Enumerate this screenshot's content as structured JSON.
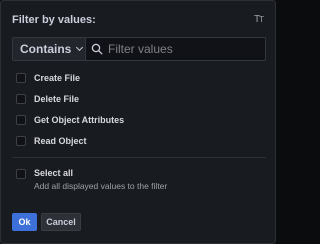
{
  "header": {
    "title": "Filter by values:",
    "toggle_icon": "text-case-icon"
  },
  "controls": {
    "operator_label": "Contains",
    "search": {
      "value": "",
      "placeholder": "Filter values"
    }
  },
  "values": [
    {
      "label": "Create File",
      "checked": false
    },
    {
      "label": "Delete File",
      "checked": false
    },
    {
      "label": "Get Object Attributes",
      "checked": false
    },
    {
      "label": "Read Object",
      "checked": false
    }
  ],
  "select_all": {
    "label": "Select all",
    "description": "Add all displayed values to the filter",
    "checked": false
  },
  "footer": {
    "ok_label": "Ok",
    "cancel_label": "Cancel"
  },
  "colors": {
    "panel_bg": "#181b1f",
    "primary": "#3d71d9",
    "text": "#ccccdc",
    "muted_text": "#9fa1a8"
  }
}
